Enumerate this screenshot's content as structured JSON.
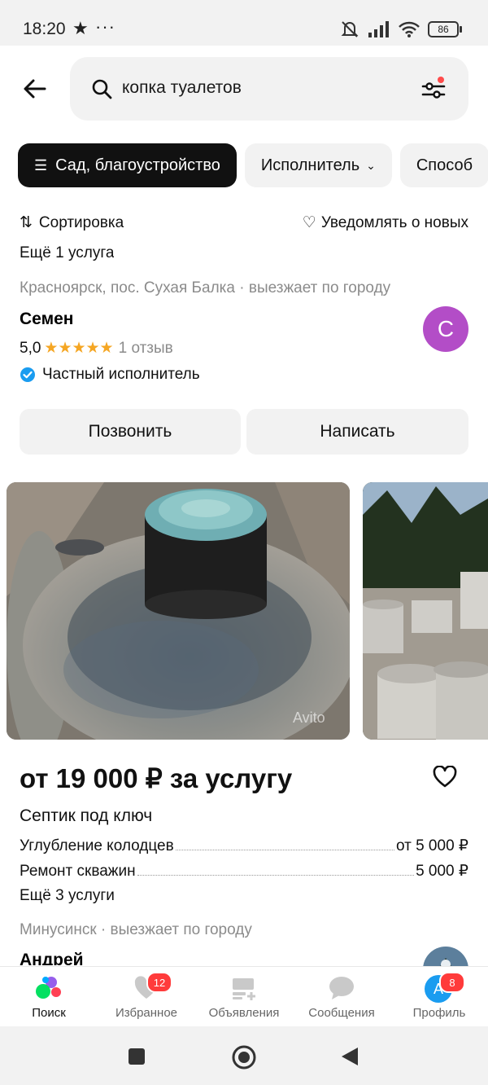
{
  "status": {
    "time": "18:20",
    "battery": "86"
  },
  "search": {
    "query": "копка туалетов"
  },
  "chips": [
    {
      "label": "Сад, благоустройство",
      "icon": "list-search-icon"
    },
    {
      "label": "Исполнитель"
    },
    {
      "label": "Способ"
    }
  ],
  "sortbar": {
    "sort_label": "Сортировка",
    "notify_label": "Уведомлять о новых"
  },
  "card1": {
    "more_services": "Ещё 1 услуга",
    "location": "Красноярск, пос. Сухая Балка · выезжает по городу",
    "name": "Семен",
    "rating": "5,0",
    "stars": "★★★★★",
    "reviews": "1 отзыв",
    "verified": "Частный исполнитель",
    "avatar_letter": "С",
    "call_label": "Позвонить",
    "write_label": "Написать"
  },
  "card2": {
    "watermark": "Avito",
    "price": "от 19 000 ₽ за услугу",
    "title": "Септик под ключ",
    "services": [
      {
        "name": "Углубление колодцев",
        "price": "от 5 000 ₽"
      },
      {
        "name": "Ремонт скважин",
        "price": "5 000 ₽"
      }
    ],
    "more_services": "Ещё 3 услуги",
    "location": "Минусинск · выезжает по городу",
    "name": "Андрей"
  },
  "tabs": [
    {
      "label": "Поиск"
    },
    {
      "label": "Избранное",
      "badge": "12"
    },
    {
      "label": "Объявления"
    },
    {
      "label": "Сообщения"
    },
    {
      "label": "Профиль",
      "badge": "8",
      "avatar_letter": "А"
    }
  ],
  "colors": {
    "accent_star": "#f5a623",
    "avatar_purple": "#b34dc7",
    "badge_red": "#ff3b3b",
    "verified_blue": "#1a9cf0"
  }
}
